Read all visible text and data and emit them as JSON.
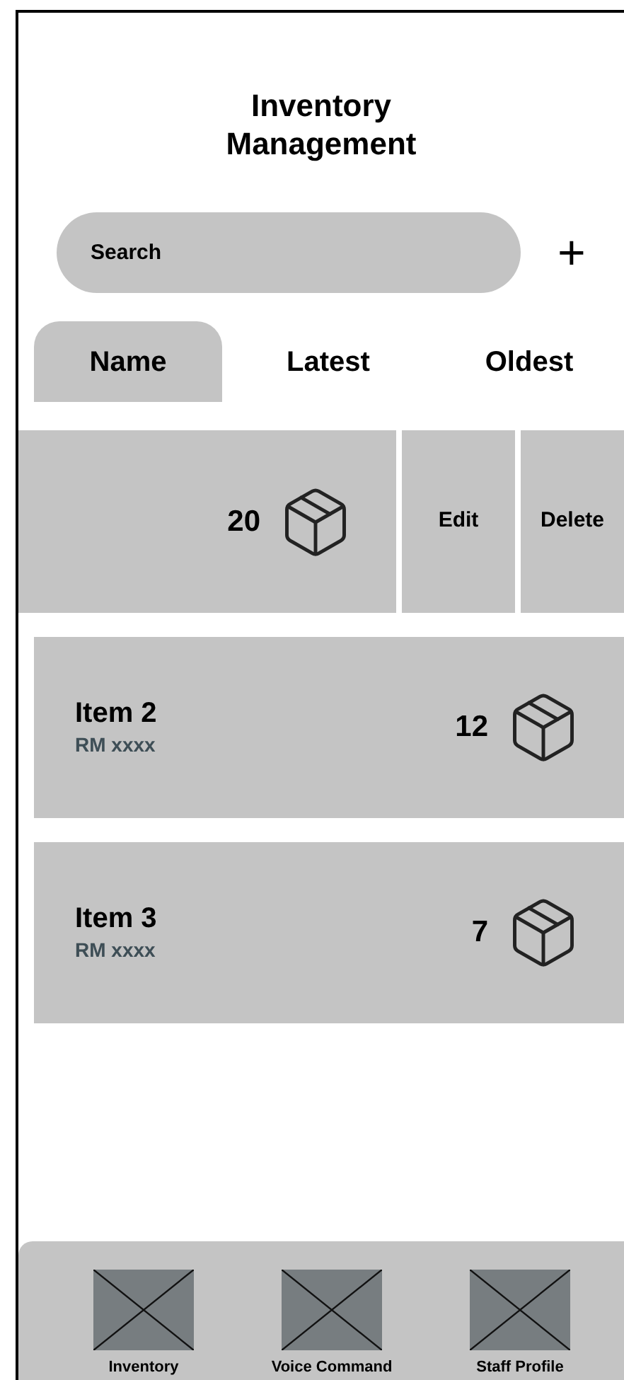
{
  "title": "Inventory Management",
  "search": {
    "placeholder": "Search"
  },
  "add_button": {
    "label": "+"
  },
  "tabs": [
    {
      "label": "Name",
      "selected": true
    },
    {
      "label": "Latest",
      "selected": false
    },
    {
      "label": "Oldest",
      "selected": false
    }
  ],
  "items": [
    {
      "kind": "swiped",
      "quantity": "20",
      "actions": [
        "Edit",
        "Delete"
      ]
    },
    {
      "kind": "item",
      "name": "Item 2",
      "price": "RM xxxx",
      "quantity": "12"
    },
    {
      "kind": "item",
      "name": "Item 3",
      "price": "RM xxxx",
      "quantity": "7"
    }
  ],
  "nav": [
    {
      "label": "Inventory"
    },
    {
      "label": "Voice Command"
    },
    {
      "label": "Staff Profile"
    }
  ]
}
